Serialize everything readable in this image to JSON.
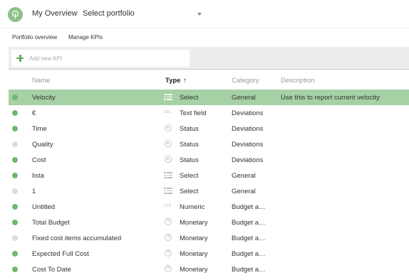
{
  "header": {
    "app_title": "My Overview",
    "portfolio_select": "Select portfolio"
  },
  "nav": {
    "portfolio_overview": "Portfolio overview",
    "manage_kpis": "Manage KPIs"
  },
  "add_kpi": {
    "placeholder": "Add new KPI"
  },
  "table": {
    "columns": {
      "name": "Name",
      "type": "Type",
      "sort_arrow": "↑",
      "category": "Category",
      "description": "Description"
    },
    "rows": [
      {
        "status": "green",
        "name": "Velocity",
        "type_icon": "list-icon",
        "type": "Select",
        "category": "General",
        "description": "Use this to report current velocity",
        "selected": true
      },
      {
        "status": "green",
        "name": "€",
        "type_icon": "text-field-icon",
        "type": "Text field",
        "category": "Deviations",
        "description": ""
      },
      {
        "status": "green",
        "name": "Time",
        "type_icon": "status-icon",
        "type": "Status",
        "category": "Deviations",
        "description": ""
      },
      {
        "status": "grey",
        "name": "Quality",
        "type_icon": "status-icon",
        "type": "Status",
        "category": "Deviations",
        "description": ""
      },
      {
        "status": "green",
        "name": "Cost",
        "type_icon": "status-icon",
        "type": "Status",
        "category": "Deviations",
        "description": ""
      },
      {
        "status": "green",
        "name": "lista",
        "type_icon": "list-icon",
        "type": "Select",
        "category": "General",
        "description": ""
      },
      {
        "status": "grey",
        "name": "1",
        "type_icon": "list-icon",
        "type": "Select",
        "category": "General",
        "description": ""
      },
      {
        "status": "green",
        "name": "Untitled",
        "type_icon": "numeric-icon",
        "type": "Numeric",
        "category": "Budget a…",
        "description": ""
      },
      {
        "status": "green",
        "name": "Total Budget",
        "type_icon": "monetary-icon",
        "type": "Monetary",
        "category": "Budget a…",
        "description": ""
      },
      {
        "status": "grey",
        "name": "Fixed cost items accumulated",
        "type_icon": "monetary-icon",
        "type": "Monetary",
        "category": "Budget a…",
        "description": ""
      },
      {
        "status": "green",
        "name": "Expected Full Cost",
        "type_icon": "monetary-icon",
        "type": "Monetary",
        "category": "Budget a…",
        "description": ""
      },
      {
        "status": "green",
        "name": "Cost To Date",
        "type_icon": "monetary-icon",
        "type": "Monetary",
        "category": "Budget a…",
        "description": ""
      }
    ]
  },
  "icon_glyphs": {
    "text_field": "abc",
    "numeric": "123",
    "monetary": "$"
  },
  "colors": {
    "accent_green": "#70b870",
    "selected_row": "#a5d1a4",
    "inactive_dot": "#dcdcdc"
  }
}
